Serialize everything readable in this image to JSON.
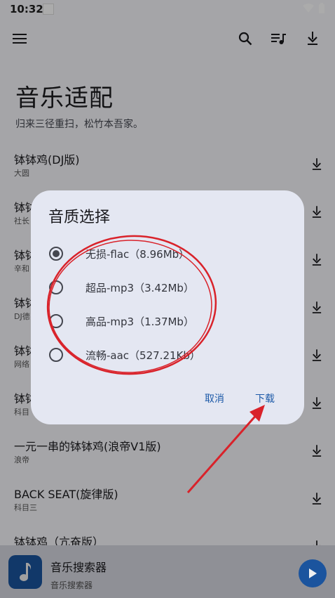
{
  "status_bar": {
    "time": "10:32"
  },
  "app_bar": {
    "menu_icon": "menu-icon",
    "search_icon": "search-icon",
    "queue_icon": "queue-music-icon",
    "download_icon": "download-icon"
  },
  "page": {
    "title": "音乐适配",
    "subtitle": "归来三径重扫，松竹本吾家。"
  },
  "songs": [
    {
      "title": "钵钵鸡(DJ版)",
      "artist": "大圆"
    },
    {
      "title": "钵钵",
      "artist": "社长"
    },
    {
      "title": "钵钵",
      "artist": "辛和"
    },
    {
      "title": "钵钵",
      "artist": "DJ德"
    },
    {
      "title": "钵钵",
      "artist": "网络"
    },
    {
      "title": "钵钵",
      "artist": "科目"
    },
    {
      "title": "一元一串的钵钵鸡(浪帝V1版)",
      "artist": "浪帝"
    },
    {
      "title": "BACK SEAT(旋律版)",
      "artist": "科目三"
    },
    {
      "title": "钵钵鸡（亢奋版）",
      "artist": ""
    }
  ],
  "dialog": {
    "title": "音质选择",
    "options": [
      {
        "label": "无损-flac（8.96Mb）",
        "selected": true
      },
      {
        "label": "超品-mp3（3.42Mb）",
        "selected": false
      },
      {
        "label": "高品-mp3（1.37Mb）",
        "selected": false
      },
      {
        "label": "流畅-aac（527.21Kb）",
        "selected": false
      }
    ],
    "cancel_label": "取消",
    "confirm_label": "下载"
  },
  "player": {
    "title": "音乐搜索器",
    "subtitle": "音乐搜索器",
    "art_icon": "music-note-icon",
    "play_icon": "play-icon"
  },
  "colors": {
    "accent": "#1d5aa8",
    "annotation": "#d9222a",
    "dialog_bg": "#e4e7f2"
  }
}
